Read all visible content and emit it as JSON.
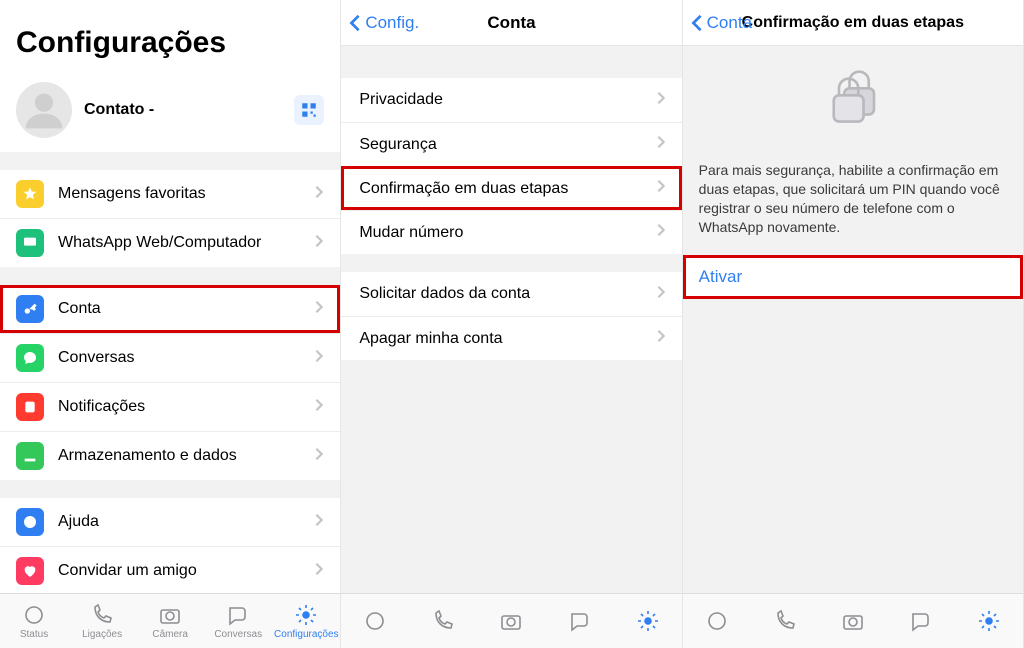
{
  "panel1": {
    "title": "Configurações",
    "profile_name": "Contato -",
    "group1": [
      {
        "label": "Mensagens favoritas"
      },
      {
        "label": "WhatsApp Web/Computador"
      }
    ],
    "group2": [
      {
        "label": "Conta"
      },
      {
        "label": "Conversas"
      },
      {
        "label": "Notificações"
      },
      {
        "label": "Armazenamento e dados"
      }
    ],
    "group3": [
      {
        "label": "Ajuda"
      },
      {
        "label": "Convidar um amigo"
      }
    ]
  },
  "panel2": {
    "back": "Config.",
    "title": "Conta",
    "group1": [
      {
        "label": "Privacidade"
      },
      {
        "label": "Segurança"
      },
      {
        "label": "Confirmação em duas etapas"
      },
      {
        "label": "Mudar número"
      }
    ],
    "group2": [
      {
        "label": "Solicitar dados da conta"
      },
      {
        "label": "Apagar minha conta"
      }
    ]
  },
  "panel3": {
    "back": "Conta",
    "title": "Confirmação em duas etapas",
    "info": "Para mais segurança, habilite a confirmação em duas etapas, que solicitará um PIN quando você registrar o seu número de telefone com o WhatsApp novamente.",
    "action": "Ativar"
  },
  "tabs": {
    "status": "Status",
    "calls": "Ligações",
    "camera": "Câmera",
    "chats": "Conversas",
    "settings": "Configurações"
  }
}
